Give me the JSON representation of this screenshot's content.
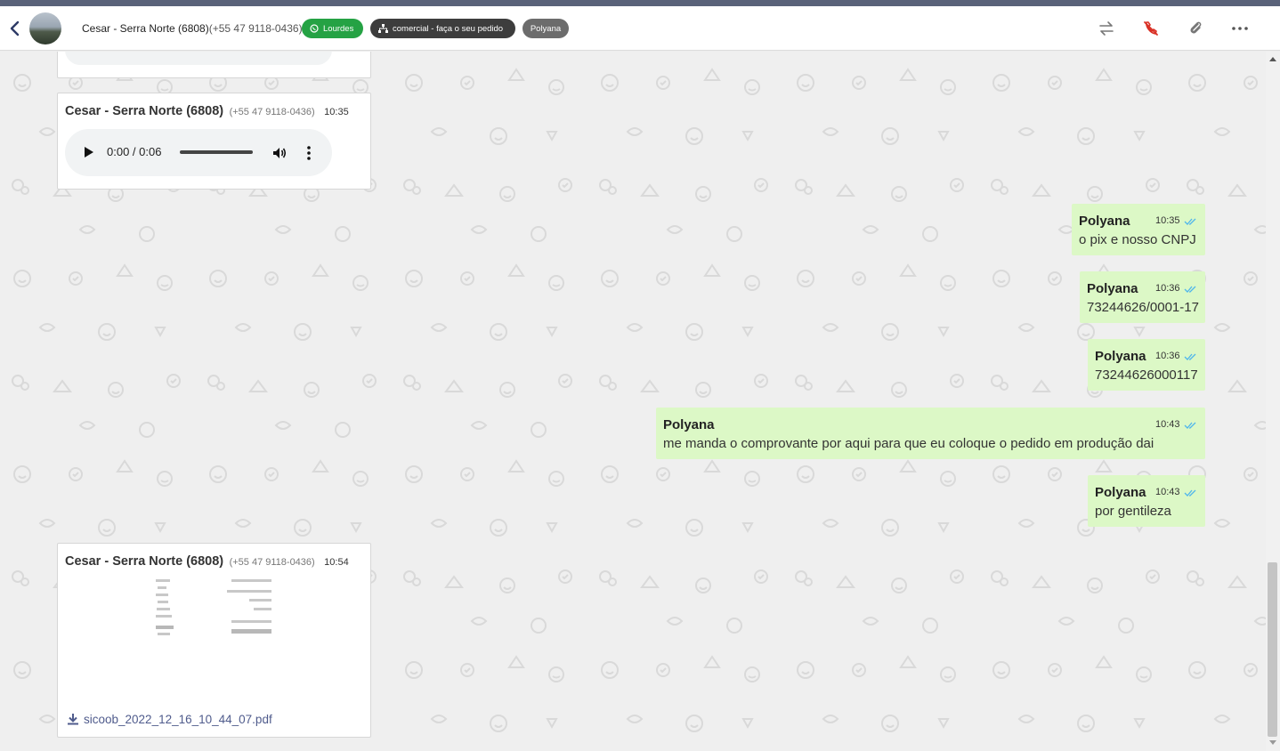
{
  "header": {
    "contact_name": "Cesar - Serra Norte (6808)",
    "contact_phone": "(+55 47 9118-0436)",
    "tags": {
      "whatsapp_label": "Lourdes",
      "queue_label": "comercial - faça o seu pedido",
      "user_label": "Polyana"
    },
    "icons": [
      "back-arrow",
      "transfer-icon",
      "end-call-icon",
      "paperclip-icon",
      "more-horizontal-icon"
    ]
  },
  "colors": {
    "outgoing_bubble": "#dcf8c6",
    "incoming_card": "#ffffff",
    "tag_green": "#25a244",
    "tag_dark": "#3d3d3d",
    "tag_grey": "#6c6c6c",
    "end_call_red": "#d93025",
    "check_blue": "#4fb6ec"
  },
  "messages": {
    "audio": {
      "sender": "Cesar - Serra Norte (6808)",
      "phone": "(+55 47 9118-0436)",
      "time": "10:35",
      "player_time": "0:00 / 0:06"
    },
    "out": [
      {
        "sender": "Polyana",
        "time": "10:35",
        "text": "o pix e nosso CNPJ"
      },
      {
        "sender": "Polyana",
        "time": "10:36",
        "text": "73244626/0001-17"
      },
      {
        "sender": "Polyana",
        "time": "10:36",
        "text": "73244626000117"
      },
      {
        "sender": "Polyana",
        "time": "10:43",
        "text": "me manda o comprovante por aqui para que eu coloque o pedido em produção dai"
      },
      {
        "sender": "Polyana",
        "time": "10:43",
        "text": "por gentileza"
      }
    ],
    "pdf": {
      "sender": "Cesar - Serra Norte (6808)",
      "phone": "(+55 47 9118-0436)",
      "time": "10:54",
      "filename": "sicoob_2022_12_16_10_44_07.pdf"
    }
  }
}
